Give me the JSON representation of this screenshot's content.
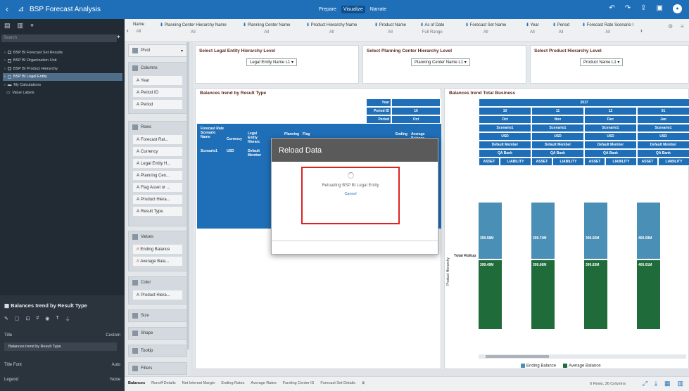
{
  "app": {
    "title": "BSP Forecast Analysis",
    "modes": [
      "Prepare",
      "Visualize",
      "Narrate"
    ],
    "active_mode": "Visualize"
  },
  "left": {
    "search_placeholder": "Search",
    "tree": [
      "BSP BI Forecast Set Results",
      "BSP BI Organization Unit",
      "BSP BI Product Hierarchy",
      "BSP BI Legal Entity",
      "My Calculations",
      "Value Labels"
    ],
    "viz_title": "Balances trend by Result Type",
    "props": {
      "title_label": "Title",
      "title_value": "Custom",
      "title_text": "Balances trend by Result Type",
      "font_label": "Title Font",
      "font_value": "Auto",
      "legend_label": "Legend",
      "legend_value": "None"
    }
  },
  "grammar": {
    "viz_type": "Pivot",
    "columns_label": "Columns",
    "columns": [
      "Year",
      "Period ID",
      "Period"
    ],
    "rows_label": "Rows",
    "rows": [
      "Forecast Rat...",
      "Currency",
      "Legal Entity H...",
      "Planning Cen...",
      "Flag Asset or ...",
      "Product Hiera...",
      "Result Type"
    ],
    "values_label": "Values",
    "values": [
      "Ending Balance",
      "Average Bala..."
    ],
    "color_label": "Color",
    "color": [
      "Product Hiera..."
    ],
    "size_label": "Size",
    "shape_label": "Shape",
    "tooltip_label": "Tooltip",
    "filters_label": "Filters"
  },
  "filters": [
    {
      "name": "Name",
      "value": "All"
    },
    {
      "name": "Planning Center Hierarchy Name",
      "value": "All"
    },
    {
      "name": "Planning Center Name",
      "value": "All"
    },
    {
      "name": "Product Hierarchy Name",
      "value": "All"
    },
    {
      "name": "Product Name",
      "value": "All"
    },
    {
      "name": "As of Date",
      "value": "Full Range"
    },
    {
      "name": "Forecast Set Name",
      "value": "All"
    },
    {
      "name": "Year",
      "value": "All"
    },
    {
      "name": "Period",
      "value": "All"
    },
    {
      "name": "Forecast Rate Scenario I",
      "value": "All"
    }
  ],
  "selectors": [
    {
      "title": "Select Legal Entity Hierarchy Level",
      "value": "Legal Entity Name L1"
    },
    {
      "title": "Select Planning Center Hierarchy Level",
      "value": "Planning Center Name L1"
    },
    {
      "title": "Select Product Hierarchy Level",
      "value": "Product Name L1"
    }
  ],
  "chartA": {
    "title": "Balances trend by Result Type",
    "col_hdrs": {
      "year": "Year",
      "period_id": "Period ID",
      "period_id_val": "10",
      "period": "Period",
      "period_val": "Oct"
    },
    "row_hdrs": [
      "Forecast Rate Scenario Name",
      "Currency",
      "Legal Entity Hierarc",
      "Planning",
      "Flag",
      "Ending",
      "Average Balance"
    ],
    "row_vals": [
      "Scenario1",
      "USD",
      "Default Member"
    ],
    "partial_vals": [
      "M",
      "M",
      "0M",
      "7K",
      "0K",
      "7K"
    ]
  },
  "chartB": {
    "title": "Balances trend Total Business",
    "year": "2017",
    "periods": [
      {
        "id": "10",
        "name": "Oct"
      },
      {
        "id": "11",
        "name": "Nov"
      },
      {
        "id": "12",
        "name": "Dec"
      },
      {
        "id": "01",
        "name": "Jan"
      }
    ],
    "scenario": "Scenario1",
    "currency": "USD",
    "member": "Default Member",
    "bank": "QA Bank",
    "asset": "ASSET",
    "liability": "LIABILITY",
    "row_axis": "Product Hierarchy",
    "row_label": "Total Rollup",
    "top_values": [
      "399.58M",
      "399.74M",
      "399.92M",
      "400.09M"
    ],
    "bottom_values": [
      "399.49M",
      "399.66M",
      "399.83M",
      "400.01M"
    ],
    "legend": [
      {
        "name": "Ending Balance",
        "color": "#4a8fb5"
      },
      {
        "name": "Average Balance",
        "color": "#1f6b3a"
      }
    ]
  },
  "modal": {
    "title": "Reload Data",
    "message": "Reloading BSP BI Legal Entity",
    "cancel": "Cancel"
  },
  "bottom": {
    "tabs": [
      "Balances",
      "Runoff Details",
      "Net Interest Margin",
      "Ending Rates",
      "Average Rates",
      "Funding Center IS",
      "Forecast Set Details"
    ],
    "status": "6 Rows, 36 Columns"
  }
}
